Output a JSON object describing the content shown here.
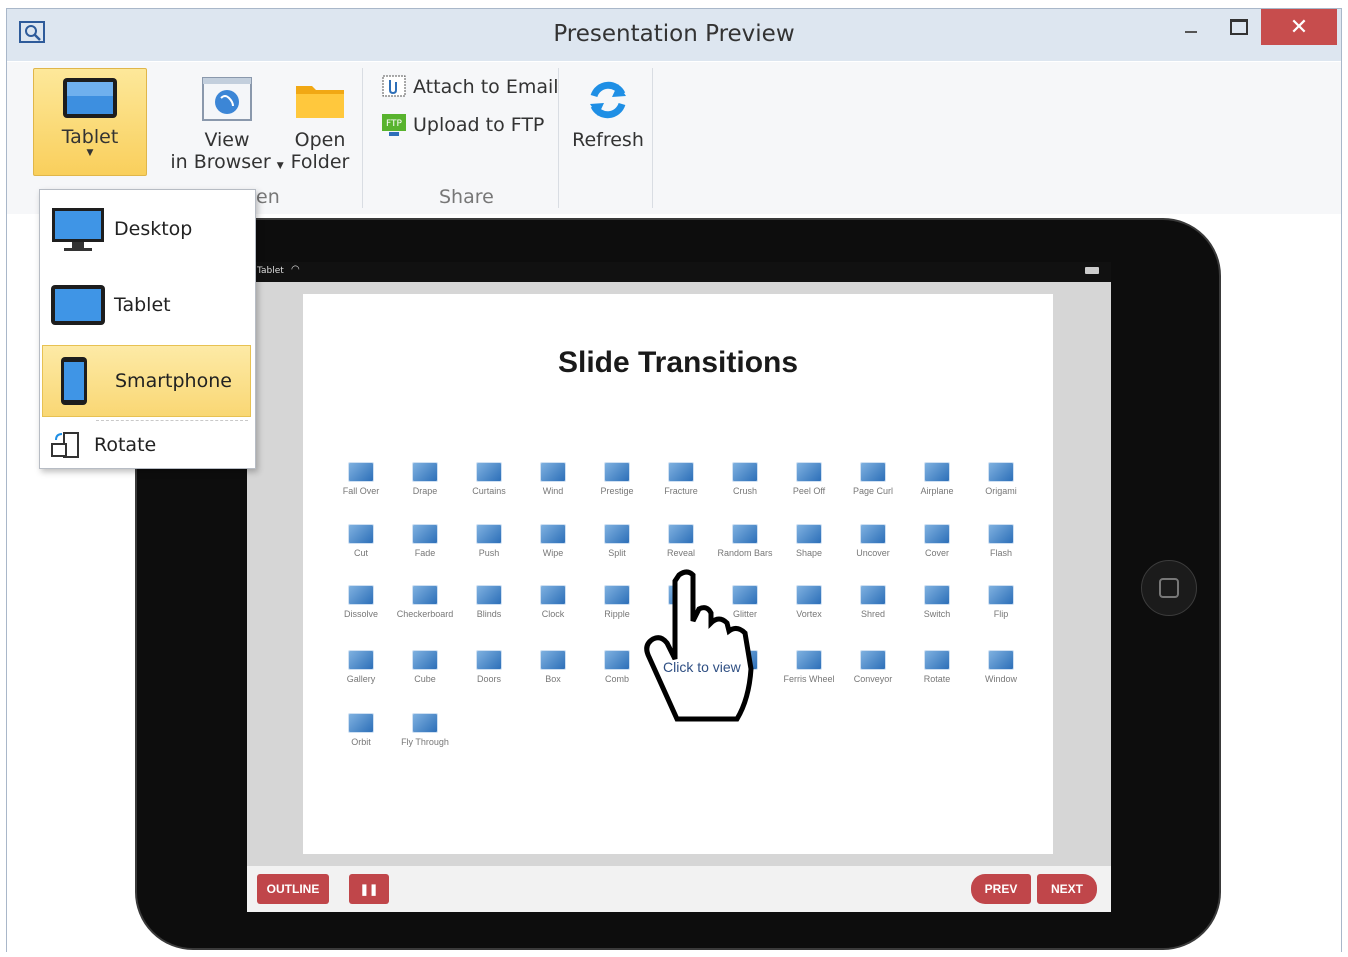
{
  "window": {
    "title": "Presentation Preview",
    "close_glyph": "✕"
  },
  "ribbon": {
    "tablet_label": "Tablet",
    "view_line1": "View",
    "view_line2": "in Browser",
    "open_line1": "Open",
    "open_line2": "Folder",
    "open_group_label": "Open",
    "attach_email": "Attach to Email",
    "upload_ftp": "Upload to FTP",
    "ftp_badge": "FTP",
    "share_group_label": "Share",
    "refresh_label": "Refresh"
  },
  "device_menu": {
    "items": [
      {
        "label": "Desktop",
        "icon": "desktop-icon"
      },
      {
        "label": "Tablet",
        "icon": "tablet-icon"
      },
      {
        "label": "Smartphone",
        "icon": "smartphone-icon",
        "selected": true
      }
    ],
    "rotate_label": "Rotate"
  },
  "device": {
    "status_label": "Tablet"
  },
  "slide": {
    "title": "Slide Transitions",
    "transitions": [
      [
        "Fall Over",
        "Drape",
        "Curtains",
        "Wind",
        "Prestige",
        "Fracture",
        "Crush",
        "Peel Off",
        "Page Curl",
        "Airplane",
        "Origami"
      ],
      [
        "Cut",
        "Fade",
        "Push",
        "Wipe",
        "Split",
        "Reveal",
        "Random Bars",
        "Shape",
        "Uncover",
        "Cover",
        "Flash"
      ],
      [
        "Dissolve",
        "Checkerboard",
        "Blinds",
        "Clock",
        "Ripple",
        "",
        "Glitter",
        "Vortex",
        "Shred",
        "Switch",
        "Flip"
      ],
      [
        "Gallery",
        "Cube",
        "Doors",
        "Box",
        "Comb",
        "",
        "",
        "Ferris Wheel",
        "Conveyor",
        "Rotate",
        "Window"
      ],
      [
        "Orbit",
        "Fly Through"
      ]
    ],
    "tooltip": "Click to view"
  },
  "player": {
    "outline_label": "OUTLINE",
    "pause_glyph": "❚❚",
    "prev_label": "PREV",
    "next_label": "NEXT"
  },
  "colors": {
    "accent_red": "#c0464a",
    "selection_yellow": "#f9d774",
    "titlebar": "#dde6f0"
  }
}
